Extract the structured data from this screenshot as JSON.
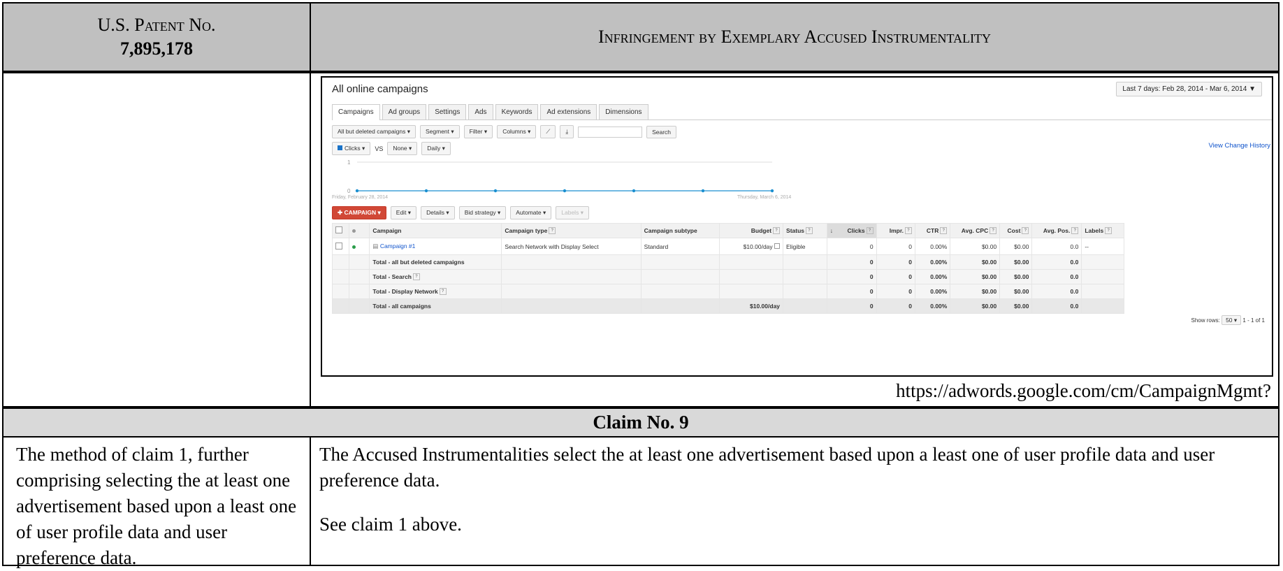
{
  "header": {
    "patent_label": "U.S. Patent No.",
    "patent_number": "7,895,178",
    "infringement_label": "Infringement by Exemplary Accused Instrumentality"
  },
  "screenshot": {
    "page_title": "All online campaigns",
    "date_range": "Last 7 days: Feb 28, 2014 - Mar 6, 2014",
    "tabs": [
      "Campaigns",
      "Ad groups",
      "Settings",
      "Ads",
      "Keywords",
      "Ad extensions",
      "Dimensions"
    ],
    "toolbar": {
      "filter_view": "All but deleted campaigns",
      "segment": "Segment",
      "filter": "Filter",
      "columns": "Columns",
      "search_button": "Search",
      "metric1": "Clicks",
      "vs": "VS",
      "metric2": "None",
      "frequency": "Daily",
      "view_change_history": "View Change History"
    },
    "chart": {
      "y_ticks": [
        "1",
        "0"
      ],
      "start_label": "Friday, February 28, 2014",
      "end_label": "Thursday, March 6, 2014"
    },
    "actions": {
      "campaign_button": "CAMPAIGN",
      "edit": "Edit",
      "details": "Details",
      "bid_strategy": "Bid strategy",
      "automate": "Automate",
      "labels": "Labels"
    },
    "table": {
      "headers": [
        "Campaign",
        "Campaign type",
        "Campaign subtype",
        "Budget",
        "Status",
        "Clicks",
        "Impr.",
        "CTR",
        "Avg. CPC",
        "Cost",
        "Avg. Pos.",
        "Labels"
      ],
      "row": {
        "campaign": "Campaign #1",
        "type": "Search Network with Display Select",
        "subtype": "Standard",
        "budget": "$10.00/day",
        "status": "Eligible",
        "clicks": "0",
        "impr": "0",
        "ctr": "0.00%",
        "avg_cpc": "$0.00",
        "cost": "$0.00",
        "avg_pos": "0.0",
        "labels": "--"
      },
      "totals": [
        {
          "label": "Total - all but deleted campaigns",
          "budget": "",
          "clicks": "0",
          "impr": "0",
          "ctr": "0.00%",
          "avg_cpc": "$0.00",
          "cost": "$0.00",
          "avg_pos": "0.0"
        },
        {
          "label": "Total - Search",
          "budget": "",
          "clicks": "0",
          "impr": "0",
          "ctr": "0.00%",
          "avg_cpc": "$0.00",
          "cost": "$0.00",
          "avg_pos": "0.0"
        },
        {
          "label": "Total - Display Network",
          "budget": "",
          "clicks": "0",
          "impr": "0",
          "ctr": "0.00%",
          "avg_cpc": "$0.00",
          "cost": "$0.00",
          "avg_pos": "0.0"
        },
        {
          "label": "Total - all campaigns",
          "budget": "$10.00/day",
          "clicks": "0",
          "impr": "0",
          "ctr": "0.00%",
          "avg_cpc": "$0.00",
          "cost": "$0.00",
          "avg_pos": "0.0"
        }
      ]
    },
    "show_rows_label": "Show rows:",
    "show_rows_value": "50",
    "pagination": "1 - 1 of 1",
    "accent_red": "#d14836",
    "link_blue": "#1155cc"
  },
  "source_url": "https://adwords.google.com/cm/CampaignMgmt?",
  "claim": {
    "title": "Claim No. 9",
    "claim_text": "The method of claim 1, further comprising selecting the at least one advertisement based upon a least one of user profile data and user preference data.",
    "infringement_text": "The Accused Instrumentalities select the at least one advertisement based upon a least one of user profile data and user preference data.",
    "see_also": "See claim 1 above."
  }
}
